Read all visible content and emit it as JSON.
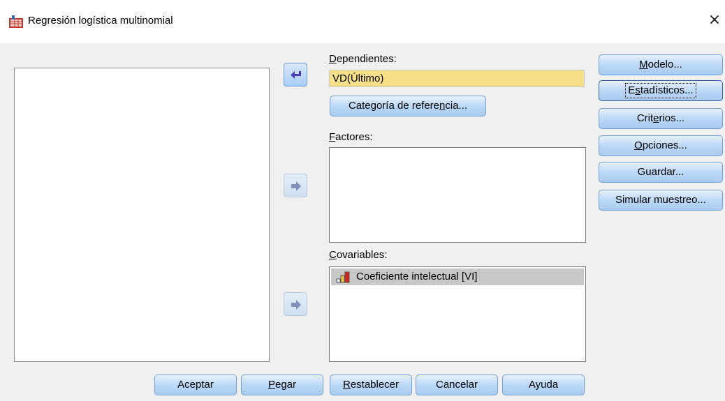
{
  "window": {
    "title": "Regresión logística multinomial",
    "close_glyph": "×"
  },
  "variables_list": {
    "items": []
  },
  "dependent": {
    "label_first": "D",
    "label_rest": "ependientes:",
    "value": "VD(Último)"
  },
  "reference_button": {
    "label_pre": "Categoría de refere",
    "label_mnemonic": "n",
    "label_post": "cia..."
  },
  "factors": {
    "label_first": "F",
    "label_rest": "actores:",
    "items": []
  },
  "covariates": {
    "label_first": "C",
    "label_rest": "ovariables:",
    "items": [
      {
        "label": "Coeficiente intelectual [VI]",
        "icon": "scale-variable-icon"
      }
    ]
  },
  "side_buttons": {
    "modelo": {
      "pre": "",
      "mn": "M",
      "post": "odelo..."
    },
    "estadisticos": {
      "pre": "E",
      "mn": "s",
      "post": "tadísticos..."
    },
    "criterios": {
      "pre": "Crit",
      "mn": "e",
      "post": "rios..."
    },
    "opciones": {
      "pre": "",
      "mn": "O",
      "post": "pciones..."
    },
    "guardar": {
      "pre": "Guardar...",
      "mn": "",
      "post": ""
    },
    "simular": {
      "pre": "Simular muestreo...",
      "mn": "",
      "post": ""
    }
  },
  "bottom_buttons": {
    "aceptar": {
      "pre": "Aceptar",
      "mn": "",
      "post": ""
    },
    "pegar": {
      "pre": "",
      "mn": "P",
      "post": "egar"
    },
    "restablecer": {
      "pre": "",
      "mn": "R",
      "post": "establecer"
    },
    "cancelar": {
      "pre": "Cancelar",
      "mn": "",
      "post": ""
    },
    "ayuda": {
      "pre": "Ayuda",
      "mn": "",
      "post": ""
    }
  },
  "colors": {
    "dependent_field": "#f8e08a",
    "button_border": "#6f9fd8",
    "selected_row": "#c8c8c8"
  }
}
